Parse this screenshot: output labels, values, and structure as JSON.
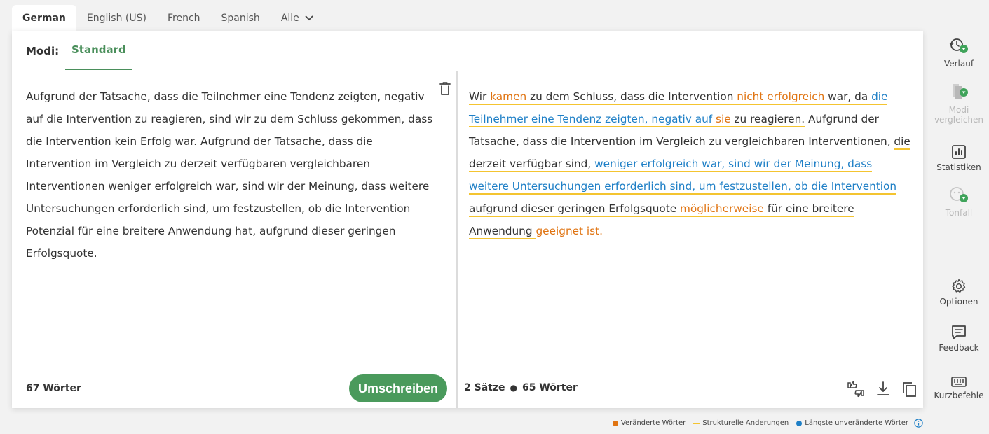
{
  "language_tabs": [
    "German",
    "English (US)",
    "French",
    "Spanish",
    "Alle"
  ],
  "modes": {
    "label": "Modi:",
    "active": "Standard"
  },
  "input": {
    "text": "Aufgrund der Tatsache, dass die Teilnehmer eine Tendenz zeigten, negativ auf die Intervention zu reagieren, sind wir zu dem Schluss gekommen, dass die Intervention kein Erfolg war. Aufgrund der Tatsache, dass die Intervention im Vergleich zu derzeit verfügbaren vergleichbaren Interventionen weniger erfolgreich war, sind wir der Meinung, dass weitere Untersuchungen erforderlich sind, um festzustellen, ob die Intervention Potenzial für eine breitere Anwendung hat, aufgrund dieser geringen Erfolgsquote.",
    "word_count": "67 Wörter"
  },
  "rewrite_button": "Umschreiben",
  "output": {
    "segments": [
      {
        "text": "Wir ",
        "style": "plain",
        "struct": true
      },
      {
        "text": "kamen",
        "style": "changed",
        "struct": true
      },
      {
        "text": " zu dem Schluss, dass die Intervention ",
        "style": "plain",
        "struct": true
      },
      {
        "text": "nicht erfolgreich",
        "style": "changed",
        "struct": true
      },
      {
        "text": " war, da ",
        "style": "plain",
        "struct": true
      },
      {
        "text": "die Teilnehmer eine Tendenz zeigten, negativ auf ",
        "style": "kept",
        "struct": true
      },
      {
        "text": "sie",
        "style": "changed",
        "struct": true
      },
      {
        "text": " zu reagieren.",
        "style": "plain",
        "struct": true
      },
      {
        "text": " Aufgrund der Tatsache, dass die Intervention im Vergleich zu vergleichbaren Interventionen, ",
        "style": "plain",
        "struct": false
      },
      {
        "text": "die",
        "style": "plain",
        "struct": true
      },
      {
        "text": " derzeit verfügbar sind, ",
        "style": "plain",
        "struct": true
      },
      {
        "text": "weniger erfolgreich war, sind wir der Meinung, dass weitere Untersuchungen erforderlich sind, um festzustellen, ob die Intervention",
        "style": "kept",
        "struct": true
      },
      {
        "text": " aufgrund dieser geringen Erfolgsquote ",
        "style": "plain",
        "struct": true
      },
      {
        "text": "möglicherweise",
        "style": "changed",
        "struct": true
      },
      {
        "text": " für eine breitere Anwendung ",
        "style": "plain",
        "struct": true
      },
      {
        "text": "geeignet ist.",
        "style": "changed",
        "struct": false
      }
    ],
    "sentences": "2 Sätze",
    "words": "65 Wörter"
  },
  "sidebar": [
    {
      "label": "Verlauf",
      "icon": "history-icon",
      "enabled": true
    },
    {
      "label": "Modi vergleichen",
      "icon": "compare-modes-icon",
      "enabled": false
    },
    {
      "label": "Statistiken",
      "icon": "statistics-icon",
      "enabled": true
    },
    {
      "label": "Tonfall",
      "icon": "tone-icon",
      "enabled": false
    },
    {
      "label": "Optionen",
      "icon": "gear-icon",
      "enabled": true
    },
    {
      "label": "Feedback",
      "icon": "feedback-icon",
      "enabled": true
    },
    {
      "label": "Kurzbefehle",
      "icon": "keyboard-icon",
      "enabled": true
    }
  ],
  "legend": {
    "changed": "Veränderte Wörter",
    "structural": "Strukturelle Änderungen",
    "unchanged": "Längste unveränderte Wörter"
  },
  "colors": {
    "accent_green": "#4a9a5c",
    "changed_orange": "#e07412",
    "unchanged_blue": "#1e7fc6",
    "structural_yellow": "#f4c430",
    "premium_badge": "#3fa35a"
  }
}
